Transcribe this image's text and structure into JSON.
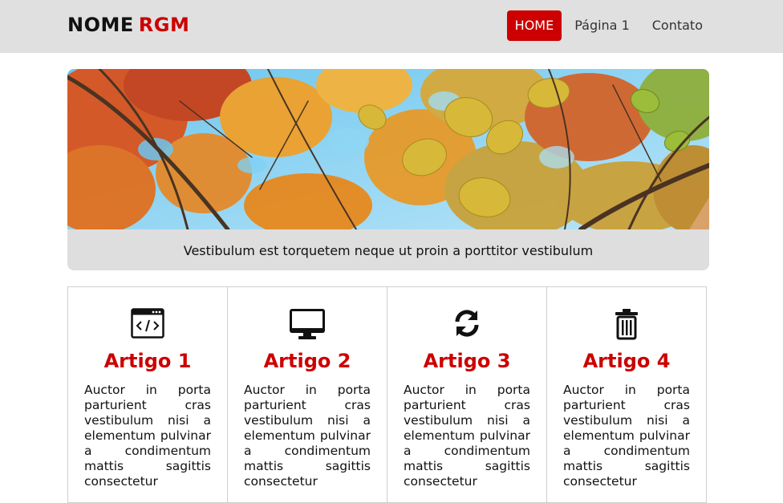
{
  "header": {
    "brand_part1": "NOME",
    "brand_part2": "RGM",
    "nav": [
      {
        "label": "HOME",
        "active": true
      },
      {
        "label": "Página 1",
        "active": false
      },
      {
        "label": "Contato",
        "active": false
      }
    ]
  },
  "hero": {
    "image_subject": "autumn trees canopy",
    "caption": "Vestibulum est torquetem neque ut proin a porttitor vestibulum"
  },
  "articles": [
    {
      "title": "Artigo 1",
      "icon": "code-window-icon",
      "text": "Auctor in porta parturient cras vestibulum nisi a elementum pulvinar a condimentum mattis sagittis consectetur"
    },
    {
      "title": "Artigo 2",
      "icon": "desktop-monitor-icon",
      "text": "Auctor in porta parturient cras vestibulum nisi a elementum pulvinar a condimentum mattis sagittis consectetur"
    },
    {
      "title": "Artigo 3",
      "icon": "refresh-icon",
      "text": "Auctor in porta parturient cras vestibulum nisi a elementum pulvinar a condimentum mattis sagittis consectetur"
    },
    {
      "title": "Artigo 4",
      "icon": "trash-icon",
      "text": "Auctor in porta parturient cras vestibulum nisi a elementum pulvinar a condimentum mattis sagittis consectetur"
    }
  ],
  "colors": {
    "accent": "#cc0000",
    "header_bg": "#e0e0e0",
    "caption_bg": "#dedede"
  }
}
